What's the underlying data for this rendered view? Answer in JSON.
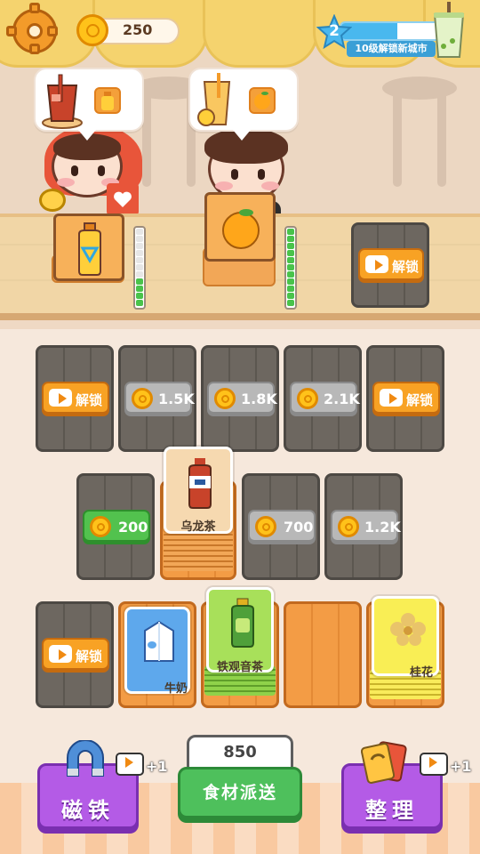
{
  "hud": {
    "coins": "250",
    "level": "2",
    "level_subtitle": "10级解锁新城市",
    "level_progress": 0.55
  },
  "customers": [
    {
      "order": "iced-tea",
      "mini": "bottle"
    },
    {
      "order": "orange-juice",
      "mini": "orange"
    }
  ],
  "counter": {
    "slots": [
      {
        "item": "bottle-tea",
        "meter_on": 4,
        "meter_total": 11
      },
      {
        "item": "orange",
        "meter_on": 11,
        "meter_total": 11
      },
      {
        "locked": true,
        "label": "解锁"
      }
    ]
  },
  "board": {
    "row1": [
      {
        "type": "unlock",
        "label": "解锁"
      },
      {
        "type": "price",
        "label": "1.5K"
      },
      {
        "type": "price",
        "label": "1.8K"
      },
      {
        "type": "price",
        "label": "2.1K"
      },
      {
        "type": "unlock",
        "label": "解锁"
      }
    ],
    "row2": [
      {
        "type": "price",
        "label": "200",
        "affordable": true
      },
      {
        "type": "card",
        "label": "乌龙茶"
      },
      {
        "type": "price",
        "label": "700"
      },
      {
        "type": "price",
        "label": "1.2K"
      }
    ],
    "row3": [
      {
        "type": "unlock",
        "label": "解锁"
      },
      {
        "type": "card",
        "label": "牛奶"
      },
      {
        "type": "card",
        "label": "铁观音茶"
      },
      {
        "type": "empty"
      },
      {
        "type": "card",
        "label": "桂花"
      }
    ]
  },
  "actions": {
    "magnet": {
      "label": "磁铁",
      "bonus": "+1"
    },
    "dispatch": {
      "price": "850",
      "label": "食材派送"
    },
    "sort": {
      "label": "整理",
      "bonus": "+1"
    }
  },
  "colors": {
    "accent_orange": "#f8a224",
    "green": "#4ec05c",
    "purple": "#b45be6"
  }
}
